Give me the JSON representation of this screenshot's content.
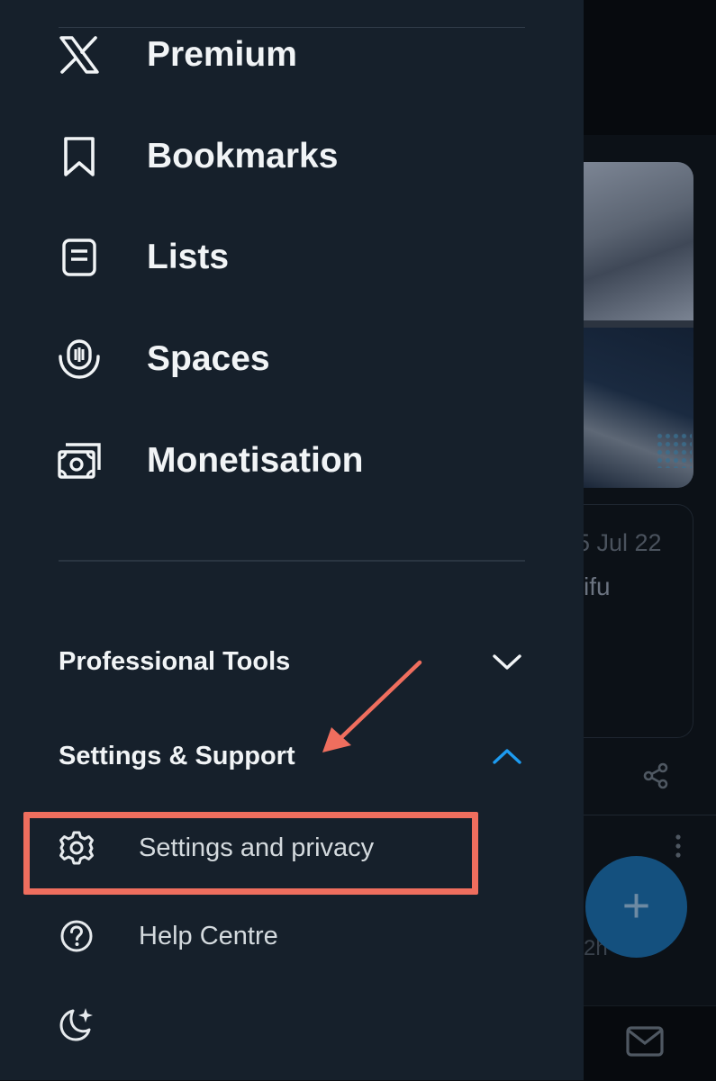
{
  "menu": {
    "items": [
      {
        "name": "premium",
        "label": "Premium",
        "icon": "x-logo-icon"
      },
      {
        "name": "bookmarks",
        "label": "Bookmarks",
        "icon": "bookmark-icon"
      },
      {
        "name": "lists",
        "label": "Lists",
        "icon": "list-icon"
      },
      {
        "name": "spaces",
        "label": "Spaces",
        "icon": "spaces-icon"
      },
      {
        "name": "monetisation",
        "label": "Monetisation",
        "icon": "money-icon"
      }
    ]
  },
  "sections": {
    "professional_tools": {
      "label": "Professional Tools",
      "expanded": false,
      "icon": "chevron-down-icon"
    },
    "settings_support": {
      "label": "Settings & Support",
      "expanded": true,
      "icon": "chevron-up-icon"
    }
  },
  "settings_support_items": [
    {
      "label": "Settings and privacy",
      "icon": "gear-icon"
    },
    {
      "label": "Help Centre",
      "icon": "help-circle-icon"
    },
    {
      "label": "",
      "icon": "moon-sparkle-icon"
    }
  ],
  "background": {
    "post_date": "5 Jul 22",
    "post_snippet": "ifu",
    "reply_time": "2h",
    "fab_icon": "plus-icon",
    "share_icon": "share-icon",
    "more_icon": "more-vertical-icon",
    "messages_icon": "mail-icon"
  },
  "annotation": {
    "highlight_color": "#ef6e5e",
    "arrow_color": "#ef6e5e",
    "accent_color": "#1d9bf0"
  }
}
